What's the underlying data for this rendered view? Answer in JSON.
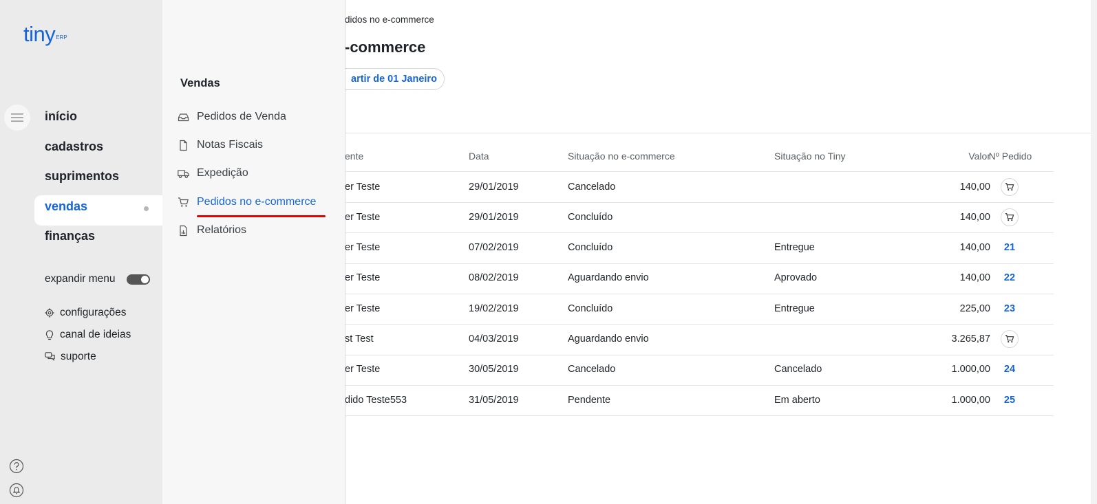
{
  "logo": {
    "text": "tiny",
    "sub": "ERP"
  },
  "nav": {
    "items": [
      {
        "label": "início"
      },
      {
        "label": "cadastros"
      },
      {
        "label": "suprimentos"
      },
      {
        "label": "vendas"
      },
      {
        "label": "finanças"
      }
    ],
    "expand_label": "expandir menu",
    "utilities": [
      {
        "label": "configurações",
        "icon": "gear-icon"
      },
      {
        "label": "canal de ideias",
        "icon": "lightbulb-icon"
      },
      {
        "label": "suporte",
        "icon": "chat-icon"
      }
    ]
  },
  "submenu": {
    "title": "Vendas",
    "items": [
      {
        "label": "Pedidos de Venda",
        "icon": "inbox-icon"
      },
      {
        "label": "Notas Fiscais",
        "icon": "document-icon"
      },
      {
        "label": "Expedição",
        "icon": "truck-icon"
      },
      {
        "label": "Pedidos no e-commerce",
        "icon": "cart-icon"
      },
      {
        "label": "Relatórios",
        "icon": "report-icon"
      }
    ]
  },
  "main": {
    "breadcrumb": "didos no e-commerce",
    "title": "-commerce",
    "filter_pill": "artir de 01 Janeiro",
    "table": {
      "headers": [
        "ente",
        "Data",
        "Situação no e-commerce",
        "Situação no Tiny",
        "Valor",
        "Nº Pedido"
      ],
      "rows": [
        {
          "cliente": "er Teste",
          "data": "29/01/2019",
          "ecommerce": "Cancelado",
          "tiny": "",
          "valor": "140,00",
          "pedido": ""
        },
        {
          "cliente": "er Teste",
          "data": "29/01/2019",
          "ecommerce": "Concluído",
          "tiny": "",
          "valor": "140,00",
          "pedido": ""
        },
        {
          "cliente": "er Teste",
          "data": "07/02/2019",
          "ecommerce": "Concluído",
          "tiny": "Entregue",
          "valor": "140,00",
          "pedido": "21"
        },
        {
          "cliente": "er Teste",
          "data": "08/02/2019",
          "ecommerce": "Aguardando envio",
          "tiny": "Aprovado",
          "valor": "140,00",
          "pedido": "22"
        },
        {
          "cliente": "er Teste",
          "data": "19/02/2019",
          "ecommerce": "Concluído",
          "tiny": "Entregue",
          "valor": "225,00",
          "pedido": "23"
        },
        {
          "cliente": "st Test",
          "data": "04/03/2019",
          "ecommerce": "Aguardando envio",
          "tiny": "",
          "valor": "3.265,87",
          "pedido": ""
        },
        {
          "cliente": "er Teste",
          "data": "30/05/2019",
          "ecommerce": "Cancelado",
          "tiny": "Cancelado",
          "valor": "1.000,00",
          "pedido": "24"
        },
        {
          "cliente": "dido Teste553",
          "data": "31/05/2019",
          "ecommerce": "Pendente",
          "tiny": "Em aberto",
          "valor": "1.000,00",
          "pedido": "25"
        }
      ]
    }
  },
  "colors": {
    "accent": "#1565d8",
    "highlight": "#e60000"
  }
}
